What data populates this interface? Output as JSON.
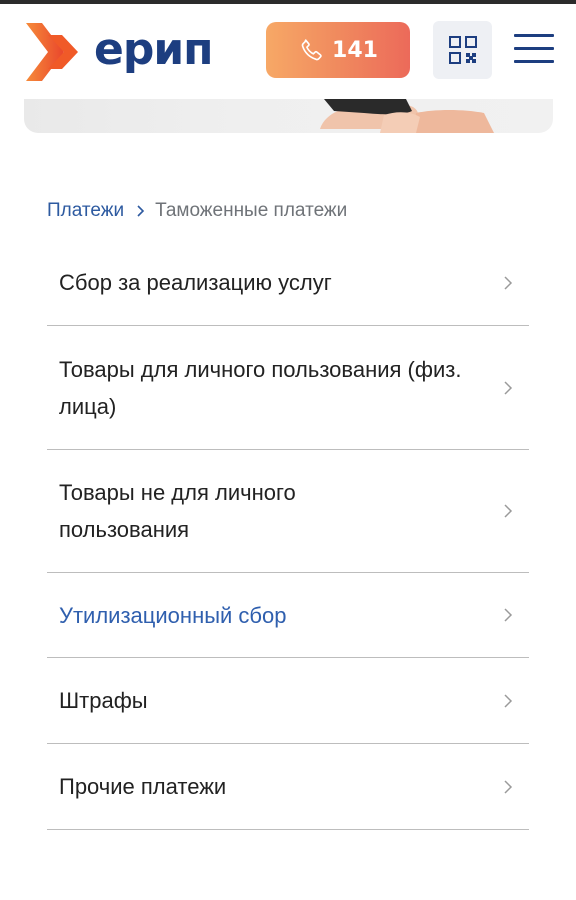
{
  "header": {
    "logo_text": "ерип",
    "call_number": "141",
    "icons": {
      "phone": "phone-icon",
      "qr": "qr-code-icon",
      "menu": "hamburger-menu-icon",
      "logo_mark": "chevron-logo-mark"
    },
    "colors": {
      "brand_blue": "#1d3e80",
      "brand_orange": "#f36f21",
      "call_gradient_start": "#f7a866",
      "call_gradient_end": "#ec6a5a"
    }
  },
  "breadcrumb": {
    "parent_label": "Платежи",
    "current_label": "Таможенные платежи"
  },
  "list": {
    "items": [
      {
        "label": "Сбор за реализацию услуг"
      },
      {
        "label": "Товары для личного пользования (физ. лица)"
      },
      {
        "label": "Товары не для личного пользования"
      },
      {
        "label": "Утилизационный сбор"
      },
      {
        "label": "Штрафы"
      },
      {
        "label": "Прочие платежи"
      }
    ]
  }
}
